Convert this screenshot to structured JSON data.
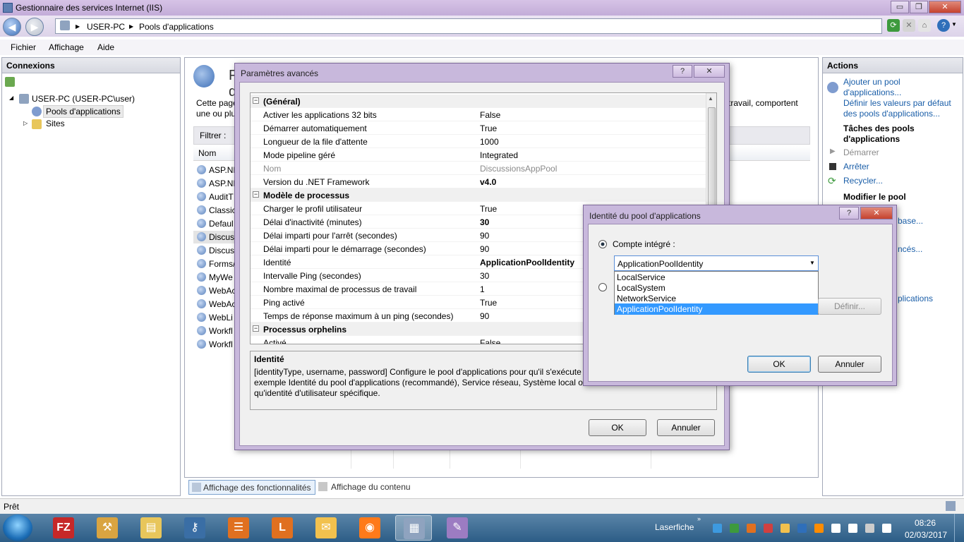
{
  "window": {
    "title": "Gestionnaire des services Internet (IIS)",
    "minimize": "▭",
    "restore": "❐",
    "close": "✕"
  },
  "address": {
    "crumbs": [
      "USER-PC",
      "Pools d'applications"
    ],
    "sep": "▶"
  },
  "menu": {
    "file": "Fichier",
    "view": "Affichage",
    "help": "Aide"
  },
  "connections": {
    "title": "Connexions",
    "server": "USER-PC (USER-PC\\user)",
    "pools": "Pools d'applications",
    "sites": "Sites"
  },
  "center": {
    "heading": "Pools d'applications",
    "desc1": "Cette page",
    "desc2": "une ou plu",
    "desc_right": "travail, comportent",
    "filter_label": "Filtrer :",
    "col_name": "Nom",
    "items": [
      "ASP.NE",
      "ASP.NE",
      "AuditT",
      "Classic",
      "Defaul",
      "Discus",
      "Discus",
      "Forms/",
      "MyWe",
      "WebAc",
      "WebAc",
      "WebLi",
      "Workfl",
      "Workfl"
    ],
    "tab_features": "Affichage des fonctionnalités",
    "tab_content": "Affichage du contenu"
  },
  "actions": {
    "title": "Actions",
    "add_pool": [
      "Ajouter un pool",
      "d'applications..."
    ],
    "set_defaults": [
      "Définir les valeurs par défaut",
      "des pools d'applications..."
    ],
    "tasks_header": [
      "Tâches des pools",
      "d'applications"
    ],
    "start": "Démarrer",
    "stop": "Arrêter",
    "recycle": "Recycler...",
    "modify_header": "Modifier le pool",
    "partial1": "base...",
    "partial2": "ncés...",
    "partial3": "plications"
  },
  "advanced": {
    "title": "Paramètres avancés",
    "help": "?",
    "close": "✕",
    "rows": [
      {
        "type": "cat",
        "k": "(Général)"
      },
      {
        "k": "Activer les applications 32 bits",
        "v": "False"
      },
      {
        "k": "Démarrer automatiquement",
        "v": "True"
      },
      {
        "k": "Longueur de la file d'attente",
        "v": "1000"
      },
      {
        "k": "Mode pipeline géré",
        "v": "Integrated"
      },
      {
        "k": "Nom",
        "v": "DiscussionsAppPool",
        "dis": true
      },
      {
        "k": "Version du .NET Framework",
        "v": "v4.0",
        "bold": true
      },
      {
        "type": "cat",
        "k": "Modèle de processus"
      },
      {
        "k": "Charger le profil utilisateur",
        "v": "True"
      },
      {
        "k": "Délai d'inactivité (minutes)",
        "v": "30",
        "bold": true
      },
      {
        "k": "Délai imparti pour l'arrêt (secondes)",
        "v": "90"
      },
      {
        "k": "Délai imparti pour le démarrage (secondes)",
        "v": "90"
      },
      {
        "k": "Identité",
        "v": "ApplicationPoolIdentity",
        "bold": true
      },
      {
        "k": "Intervalle Ping (secondes)",
        "v": "30"
      },
      {
        "k": "Nombre maximal de processus de travail",
        "v": "1"
      },
      {
        "k": "Ping activé",
        "v": "True"
      },
      {
        "k": "Temps de réponse maximum à un ping (secondes)",
        "v": "90"
      },
      {
        "type": "cat",
        "k": "Processus orphelins"
      },
      {
        "k": "Activé",
        "v": "False"
      }
    ],
    "desc_title": "Identité",
    "desc_lines": [
      "[identityType, username, password] Configure le pool d'applications pour qu'il s'exécute",
      "exemple Identité du pool d'applications (recommandé), Service réseau, Système local ou",
      "qu'identité d'utilisateur spécifique."
    ],
    "ok": "OK",
    "cancel": "Annuler"
  },
  "identity": {
    "title": "Identité du pool d'applications",
    "help": "?",
    "close": "✕",
    "builtin_label": "Compte intégré :",
    "selected": "ApplicationPoolIdentity",
    "options": [
      "LocalService",
      "LocalSystem",
      "NetworkService",
      "ApplicationPoolIdentity"
    ],
    "define": "Définir...",
    "ok": "OK",
    "cancel": "Annuler"
  },
  "status": {
    "text": "Prêt"
  },
  "taskbar": {
    "apps": [
      "FZ",
      "⚒",
      "▤",
      "⚷",
      "☰",
      "L",
      "✉",
      "◉",
      "▦",
      "✎"
    ],
    "lf_label": "Laserfiche",
    "time": "08:26",
    "date": "02/03/2017"
  },
  "colors": {
    "selection": "#3399ff",
    "link": "#1a5ea8",
    "taskbar": "#2c5d86"
  }
}
